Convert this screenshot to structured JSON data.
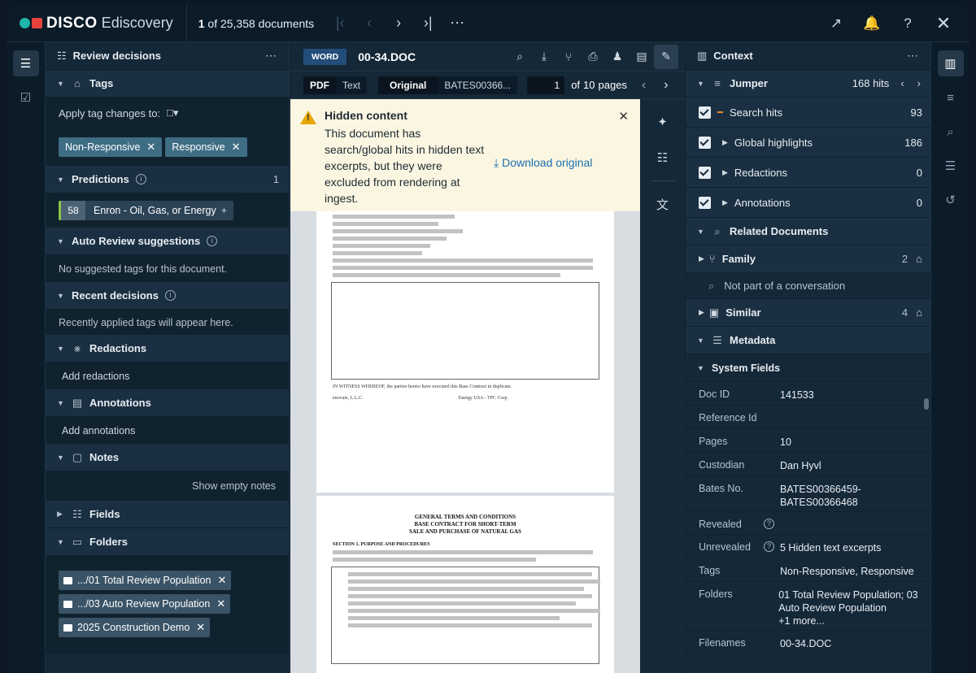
{
  "topbar": {
    "brand": "DISCO",
    "product": "Ediscovery",
    "count_bold": "1",
    "count_rest": "of 25,358 documents",
    "icons": [
      "first-page-icon",
      "prev-page-icon",
      "next-page-icon",
      "last-page-icon",
      "more-icon",
      "external-link-icon",
      "bell-icon",
      "help-icon",
      "close-icon"
    ]
  },
  "left_panel": {
    "title": "Review decisions",
    "tags_label": "Tags",
    "apply_label": "Apply tag changes to:",
    "tag_chips": [
      "Non-Responsive",
      "Responsive"
    ],
    "predictions_label": "Predictions",
    "predictions_count": "1",
    "prediction": {
      "score": "58",
      "label": "Enron - Oil, Gas, or Energy"
    },
    "auto_review_label": "Auto Review suggestions",
    "auto_review_text": "No suggested tags for this document.",
    "recent_label": "Recent decisions",
    "recent_text": "Recently applied tags will appear here.",
    "redactions_label": "Redactions",
    "add_redactions": "Add redactions",
    "annotations_label": "Annotations",
    "add_annotations": "Add annotations",
    "notes_label": "Notes",
    "show_empty_notes": "Show empty notes",
    "fields_label": "Fields",
    "folders_label": "Folders",
    "folder_chips": [
      ".../01 Total Review Population",
      ".../03 Auto Review Population",
      "2025 Construction Demo"
    ]
  },
  "viewer": {
    "badge": "WORD",
    "doc_name": "00-34.DOC",
    "mode_pdf": "PDF",
    "mode_text": "Text",
    "view_original": "Original",
    "view_bates": "BATES00366...",
    "page_value": "1",
    "page_of": "of",
    "page_total": "10",
    "page_word": "pages",
    "banner": {
      "title": "Hidden content",
      "body": "This document has search/global hits in hidden text excerpts, but they were excluded from rendering at ingest.",
      "download": "Download original"
    },
    "doc_heading": [
      "GENERAL TERMS AND CONDITIONS",
      "BASE CONTRACT FOR SHORT-TERM",
      "SALE AND PURCHASE OF NATURAL GAS"
    ],
    "section_1": "SECTION 1.  PURPOSE AND PROCEDURES",
    "witness_line": "IN WITNESS WHEREOF, the parties hereto have executed this Base Contract in duplicate.",
    "party_a": "enovate, L.L.C.",
    "party_b": "Energy USA - TPC Corp."
  },
  "right_panel": {
    "title": "Context",
    "jumper_label": "Jumper",
    "jumper_hits": "168 hits",
    "jumper_rows": [
      {
        "name": "Search hits",
        "value": "93"
      },
      {
        "name": "Global highlights",
        "value": "186"
      },
      {
        "name": "Redactions",
        "value": "0"
      },
      {
        "name": "Annotations",
        "value": "0"
      }
    ],
    "related_label": "Related Documents",
    "family_label": "Family",
    "family_count": "2",
    "conversation_text": "Not part of a conversation",
    "similar_label": "Similar",
    "similar_count": "4",
    "metadata_label": "Metadata",
    "system_fields_label": "System Fields",
    "fields": [
      {
        "k": "Doc ID",
        "v": "141533"
      },
      {
        "k": "Reference Id",
        "v": ""
      },
      {
        "k": "Pages",
        "v": "10"
      },
      {
        "k": "Custodian",
        "v": "Dan Hyvl"
      },
      {
        "k": "Bates No.",
        "v": "BATES00366459-\nBATES00366468"
      },
      {
        "k": "Revealed",
        "v": ""
      },
      {
        "k": "Unrevealed",
        "v": "5 Hidden text excerpts"
      },
      {
        "k": "Tags",
        "v": "Non-Responsive, Responsive"
      },
      {
        "k": "Folders",
        "v": "01 Total Review Population; 03 Auto Review Population\n+1 more..."
      },
      {
        "k": "Filenames",
        "v": "00-34.DOC"
      }
    ]
  },
  "colors": {
    "accent": "#1fb5a8",
    "brand_red": "#e8443d",
    "link": "#1a6fb0",
    "warning": "#e6a700"
  }
}
